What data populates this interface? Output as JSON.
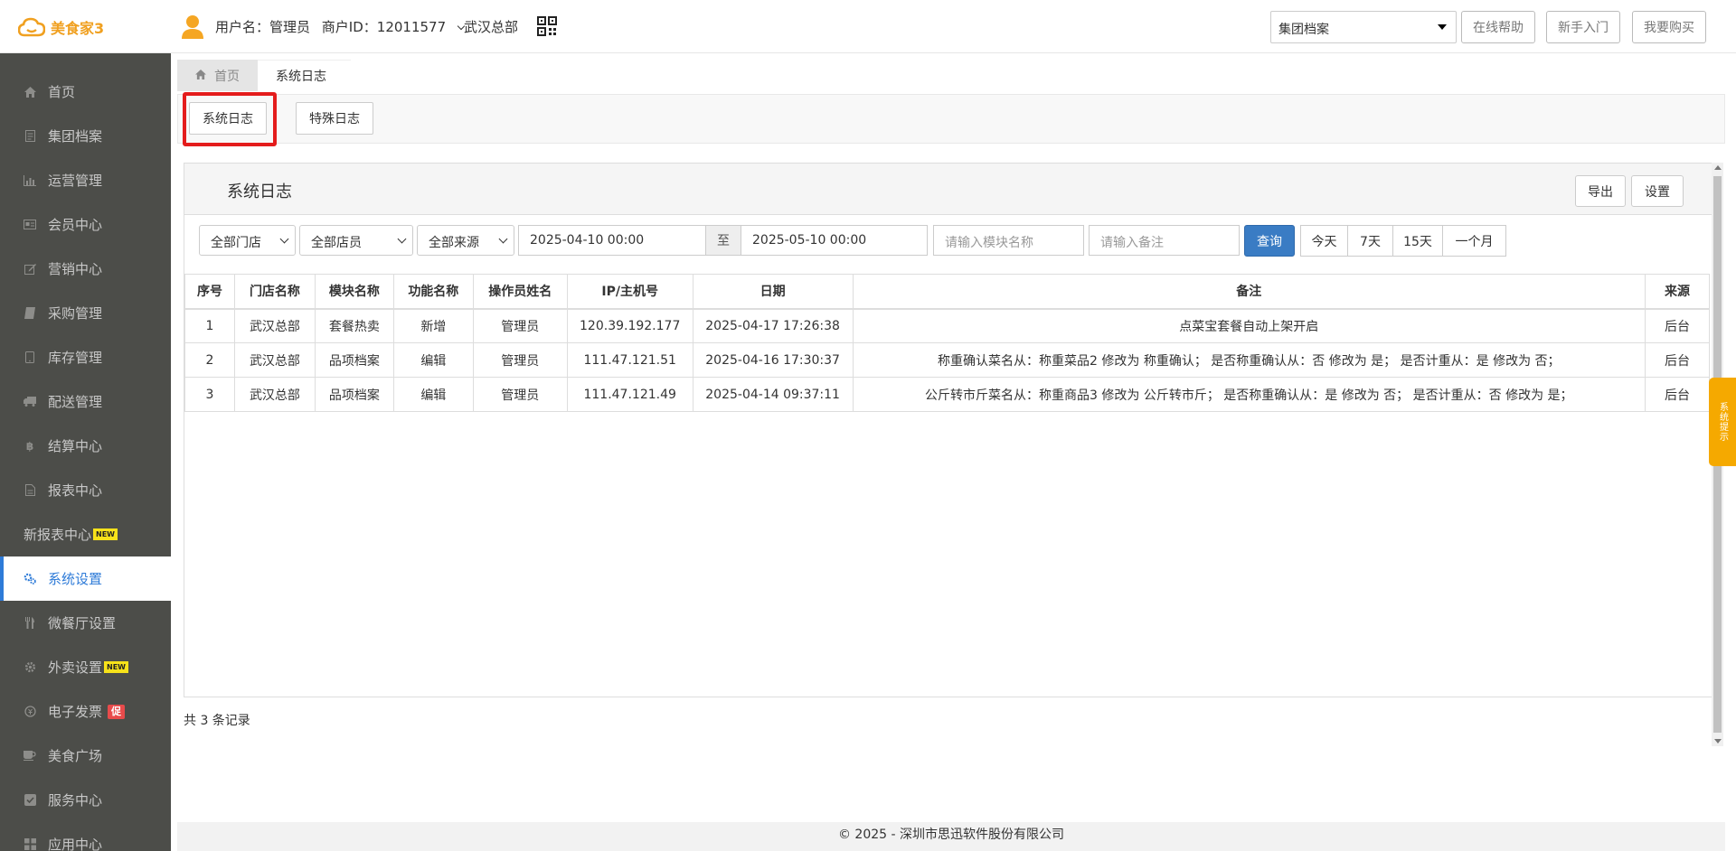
{
  "header": {
    "logo_text": "美食家3",
    "username": "用户名：管理员",
    "merchant_id": "商户ID：12011577",
    "store": "武汉总部",
    "group_select": "集团档案",
    "help_button": "在线帮助",
    "newbie_button": "新手入门",
    "buy_button": "我要购买"
  },
  "sidebar": {
    "items": [
      {
        "label": "首页",
        "icon": "home-icon"
      },
      {
        "label": "集团档案",
        "icon": "file-icon"
      },
      {
        "label": "运营管理",
        "icon": "bar-chart-icon"
      },
      {
        "label": "会员中心",
        "icon": "id-card-icon"
      },
      {
        "label": "营销中心",
        "icon": "edit-icon"
      },
      {
        "label": "采购管理",
        "icon": "book-icon"
      },
      {
        "label": "库存管理",
        "icon": "tablet-icon"
      },
      {
        "label": "配送管理",
        "icon": "truck-icon"
      },
      {
        "label": "结算中心",
        "icon": "bitcoin-icon"
      },
      {
        "label": "报表中心",
        "icon": "report-icon"
      },
      {
        "label": "新报表中心",
        "badge": "NEW"
      },
      {
        "label": "系统设置",
        "icon": "gears-icon",
        "active": true
      },
      {
        "label": "微餐厅设置",
        "icon": "cutlery-icon"
      },
      {
        "label": "外卖设置",
        "icon": "gear-icon",
        "badge": "NEW"
      },
      {
        "label": "电子发票",
        "icon": "invoice-icon",
        "badge": "促"
      },
      {
        "label": "美食广场",
        "icon": "coffee-icon"
      },
      {
        "label": "服务中心",
        "icon": "check-square-icon"
      },
      {
        "label": "应用中心",
        "icon": "apps-icon"
      }
    ]
  },
  "tabs": {
    "home": "首页",
    "current": "系统日志"
  },
  "subnav": {
    "system_log": "系统日志",
    "special_log": "特殊日志"
  },
  "panel": {
    "title": "系统日志",
    "export_button": "导出",
    "settings_button": "设置"
  },
  "filters": {
    "store": "全部门店",
    "staff": "全部店员",
    "source": "全部来源",
    "date_from": "2025-04-10 00:00",
    "to_label": "至",
    "date_to": "2025-05-10 00:00",
    "module_placeholder": "请输入模块名称",
    "remark_placeholder": "请输入备注",
    "query_button": "查询",
    "ranges": [
      "今天",
      "7天",
      "15天",
      "一个月"
    ]
  },
  "table": {
    "headers": [
      "序号",
      "门店名称",
      "模块名称",
      "功能名称",
      "操作员姓名",
      "IP/主机号",
      "日期",
      "备注",
      "来源"
    ],
    "rows": [
      [
        "1",
        "武汉总部",
        "套餐热卖",
        "新增",
        "管理员",
        "120.39.192.177",
        "2025-04-17 17:26:38",
        "点菜宝套餐自动上架开启",
        "后台"
      ],
      [
        "2",
        "武汉总部",
        "品项档案",
        "编辑",
        "管理员",
        "111.47.121.51",
        "2025-04-16 17:30:37",
        "称重确认菜名从：称重菜品2 修改为 称重确认； 是否称重确认从：否 修改为 是； 是否计重从：是 修改为 否；",
        "后台"
      ],
      [
        "3",
        "武汉总部",
        "品项档案",
        "编辑",
        "管理员",
        "111.47.121.49",
        "2025-04-14 09:37:11",
        "公斤转市斤菜名从：称重商品3 修改为 公斤转市斤； 是否称重确认从：是 修改为 否； 是否计重从：否 修改为 是；",
        "后台"
      ]
    ]
  },
  "record_count": "共 3 条记录",
  "footer": "© 2025 - 深圳市思迅软件股份有限公司",
  "tip_tab": "系统提示",
  "colors": {
    "sidebar_bg": "#4c4d49",
    "active_blue": "#2e7bd8",
    "query_blue": "#3a7cc4",
    "highlight_red": "#e41c1c",
    "tip_orange": "#f5a900",
    "logo_orange": "#f0a020"
  }
}
